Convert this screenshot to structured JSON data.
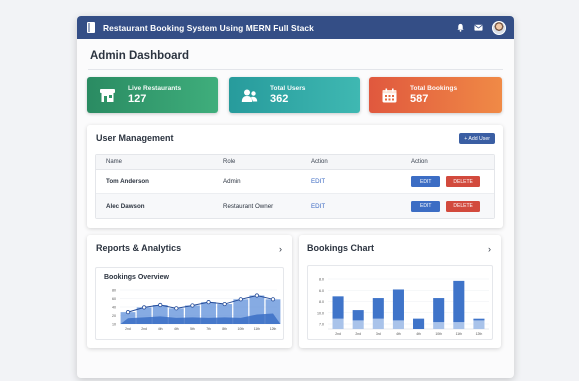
{
  "app": {
    "title": "Restaurant Booking System Using MERN Full Stack"
  },
  "page": {
    "title": "Admin Dashboard"
  },
  "stats": [
    {
      "label": "Live Restaurants",
      "value": "127",
      "icon": "storefront-icon",
      "color": "#2f9668"
    },
    {
      "label": "Total Users",
      "value": "362",
      "icon": "users-icon",
      "color": "#2ea5a4"
    },
    {
      "label": "Total Bookings",
      "value": "587",
      "icon": "calendar-icon",
      "color": "#e56b41"
    }
  ],
  "user_management": {
    "title": "User Management",
    "add_button": "+ Add User",
    "columns": [
      "Name",
      "Role",
      "Action",
      "Action"
    ],
    "rows": [
      {
        "name": "Tom Anderson",
        "role": "Admin",
        "edit_link": "EDIT",
        "edit_button": "EDIT",
        "delete_button": "DELETE"
      },
      {
        "name": "Alec Dawson",
        "role": "Restaurant Owner",
        "edit_link": "EDIT",
        "edit_button": "EDIT",
        "delete_button": "DELETE"
      }
    ]
  },
  "reports": {
    "title": "Reports & Analytics",
    "chevron": "›",
    "subtitle": "Bookings Overview"
  },
  "bookings_chart": {
    "title": "Bookings Chart",
    "chevron": "›"
  },
  "colors": {
    "header": "#344e86",
    "accent": "#3a5ea3",
    "chart_bar": "#3f74c9",
    "chart_light": "#a9c3ea",
    "delete": "#d24a3d"
  },
  "chart_data": [
    {
      "type": "area",
      "title": "Bookings Overview",
      "categories": [
        "2nd",
        "2nd",
        "4th",
        "4th",
        "5th",
        "7th",
        "8th",
        "10th",
        "11th",
        "12th"
      ],
      "series": [
        {
          "values": [
            12,
            14,
            16,
            13,
            14,
            13,
            14,
            13,
            20,
            22
          ]
        },
        {
          "values": [
            25,
            35,
            40,
            33,
            39,
            46,
            42,
            52,
            60,
            52
          ]
        }
      ],
      "yticks": [
        "80",
        "60",
        "40",
        "20",
        "10"
      ],
      "ylim": [
        0,
        80
      ]
    },
    {
      "type": "bar",
      "title": "Bookings Chart",
      "categories": [
        "2nd",
        "2nd",
        "3rd",
        "4th",
        "4th",
        "10th",
        "11th",
        "12th"
      ],
      "series": [
        {
          "values": [
            6,
            5,
            6,
            5,
            6,
            4,
            4,
            5
          ]
        },
        {
          "values": [
            19,
            11,
            18,
            23,
            6,
            18,
            28,
            6
          ]
        }
      ],
      "yticks": [
        "8.0",
        "6.0",
        "8.0",
        "10.0",
        "7.0"
      ],
      "ylim": [
        0,
        32
      ]
    }
  ]
}
